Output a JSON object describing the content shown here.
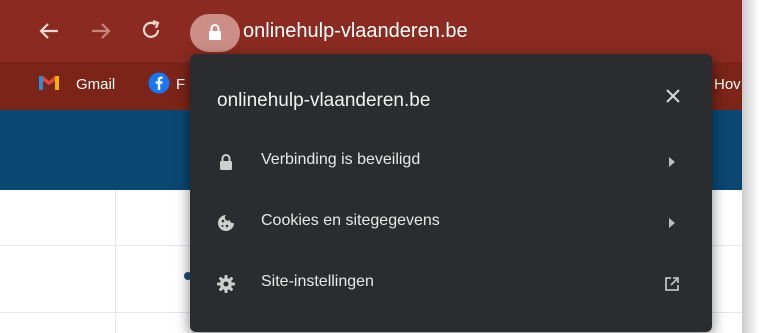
{
  "browser": {
    "url": "onlinehulp-vlaanderen.be",
    "colors": {
      "toolbar": "#8a2a20",
      "bookmarks_bar": "#7c2418",
      "site_header": "#0b4773",
      "popup_bg": "#2b2c30"
    }
  },
  "bookmarks": [
    {
      "label": "Gmail",
      "icon": "gmail-icon"
    },
    {
      "label": "F",
      "icon": "facebook-icon"
    },
    {
      "label": "Hov",
      "icon": ""
    }
  ],
  "site_info_popup": {
    "title": "onlinehulp-vlaanderen.be",
    "close_icon": "close-icon",
    "rows": [
      {
        "label": "Verbinding is beveiligd",
        "icon": "lock-icon",
        "trailing_icon": "chevron-right-icon"
      },
      {
        "label": "Cookies en sitegegevens",
        "icon": "cookie-icon",
        "trailing_icon": "chevron-right-icon"
      },
      {
        "label": "Site-instellingen",
        "icon": "gear-icon",
        "trailing_icon": "external-link-icon"
      }
    ]
  }
}
